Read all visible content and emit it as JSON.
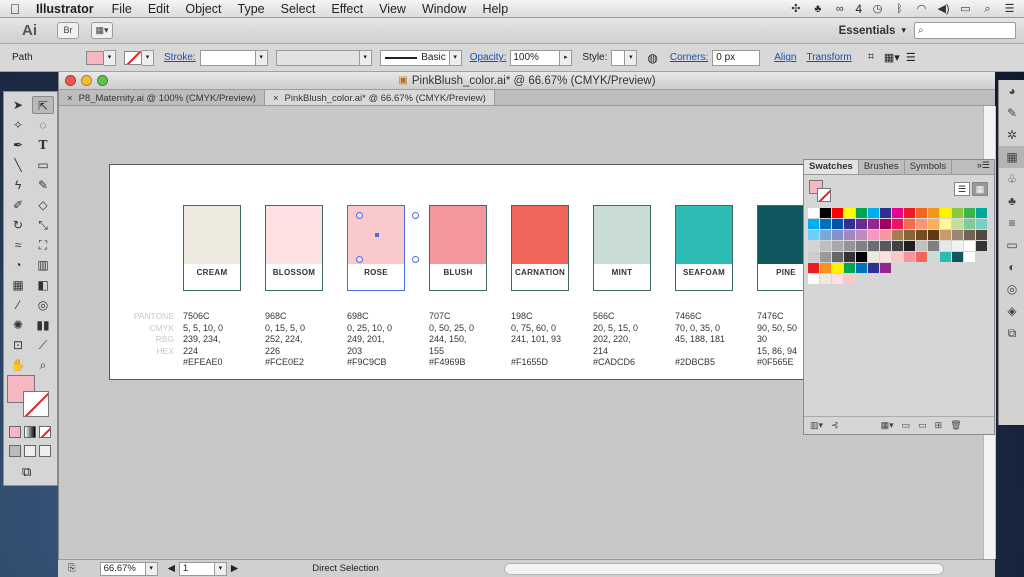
{
  "menubar": {
    "app_name": "Illustrator",
    "items": [
      "File",
      "Edit",
      "Object",
      "Type",
      "Select",
      "Effect",
      "View",
      "Window",
      "Help"
    ],
    "cc_count": "4"
  },
  "appbar": {
    "logo": "Ai",
    "bridge_label": "Br",
    "workspace": "Essentials"
  },
  "controlbar": {
    "selection_type": "Path",
    "stroke_label": "Stroke:",
    "brush_label": "Basic",
    "opacity_label": "Opacity:",
    "opacity_value": "100%",
    "style_label": "Style:",
    "corners_label": "Corners:",
    "corners_value": "0 px",
    "align_label": "Align",
    "transform_label": "Transform",
    "fill_color": "#F5B8C2"
  },
  "document": {
    "title": "PinkBlush_color.ai* @ 66.67% (CMYK/Preview)",
    "tabs": [
      {
        "label": "P8_Maternity.ai @ 100% (CMYK/Preview)",
        "close": "×"
      },
      {
        "label": "PinkBlush_color.ai* @ 66.67% (CMYK/Preview)",
        "close": "×"
      }
    ]
  },
  "artboard": {
    "spec_labels": [
      "PANTONE",
      "CMYK",
      "RBG",
      "HEX"
    ],
    "colors": [
      {
        "name": "CREAM",
        "hex_color": "#EFEAE0",
        "pantone": "7506C",
        "cmyk": "5, 5, 10, 0",
        "rgb1": "239, 234,",
        "rgb2": "224",
        "hex": "#EFEAE0"
      },
      {
        "name": "BLOSSOM",
        "hex_color": "#FCE0E2",
        "pantone": "968C",
        "cmyk": "0, 15, 5, 0",
        "rgb1": "252, 224,",
        "rgb2": "226",
        "hex": "#FCE0E2"
      },
      {
        "name": "ROSE",
        "hex_color": "#F9C9CB",
        "pantone": "698C",
        "cmyk": "0, 25, 10, 0",
        "rgb1": "249, 201,",
        "rgb2": "203",
        "hex": "#F9C9CB"
      },
      {
        "name": "BLUSH",
        "hex_color": "#F4969B",
        "pantone": "707C",
        "cmyk": "0, 50, 25, 0",
        "rgb1": "244, 150,",
        "rgb2": "155",
        "hex": "#F4969B"
      },
      {
        "name": "CARNATION",
        "hex_color": "#F1655D",
        "pantone": "198C",
        "cmyk": "0, 75, 60, 0",
        "rgb1": "241, 101, 93",
        "rgb2": "",
        "hex": "#F1655D"
      },
      {
        "name": "MINT",
        "hex_color": "#CADCD6",
        "pantone": "566C",
        "cmyk": "20, 5, 15, 0",
        "rgb1": "202, 220,",
        "rgb2": "214",
        "hex": "#CADCD6"
      },
      {
        "name": "SEAFOAM",
        "hex_color": "#2DBCB5",
        "pantone": "7466C",
        "cmyk": "70, 0, 35, 0",
        "rgb1": "45, 188, 181",
        "rgb2": "",
        "hex": "#2DBCB5"
      },
      {
        "name": "PINE",
        "hex_color": "#0F565E",
        "pantone": "7476C",
        "cmyk": "90, 50, 50",
        "rgb1": "30",
        "rgb2": "15, 86, 94",
        "hex": "#0F565E"
      }
    ]
  },
  "swatches_panel": {
    "tabs": [
      "Swatches",
      "Brushes",
      "Symbols"
    ]
  },
  "statusbar": {
    "zoom": "66.67%",
    "artboard_number": "1",
    "tool_status": "Direct Selection"
  }
}
